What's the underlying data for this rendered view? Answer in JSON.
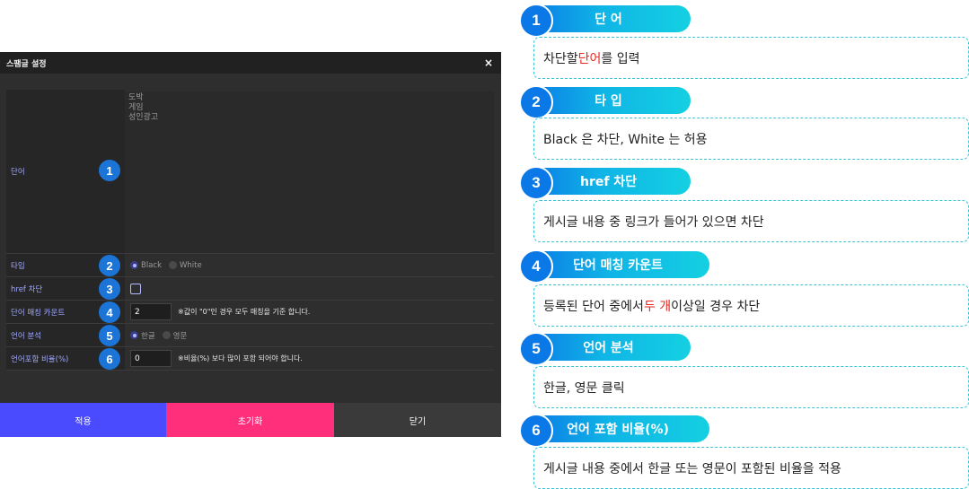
{
  "dialog": {
    "title": "스팸글 설정",
    "close_glyph": "×",
    "rows": {
      "word": {
        "label": "단어",
        "value": "도박\n게임\n성인광고",
        "badge": "1"
      },
      "type": {
        "label": "타입",
        "badge": "2",
        "options": [
          "Black",
          "White"
        ],
        "selected": "Black"
      },
      "href": {
        "label": "href 차단",
        "badge": "3",
        "checked": false
      },
      "count": {
        "label": "단어 매칭 카운트",
        "badge": "4",
        "value": "2",
        "hint": "※값이 \"0\"인 경우 모두 매칭을 기준 합니다."
      },
      "lang": {
        "label": "언어 분석",
        "badge": "5",
        "options": [
          "한글",
          "영문"
        ],
        "selected": "한글"
      },
      "ratio": {
        "label": "언어포함 비율(%)",
        "badge": "6",
        "value": "0",
        "hint": "※비율(%) 보다 많이 포함 되어야 합니다."
      }
    },
    "buttons": {
      "apply": "적용",
      "reset": "초기화",
      "close": "닫기"
    },
    "colors": {
      "apply": "#4a4bff",
      "reset": "#ff2f7c",
      "close": "#3a3a3a",
      "badge": "#1b74d6"
    }
  },
  "guide": {
    "items": [
      {
        "num": "1",
        "title": "단 어",
        "desc_pre": "차단할 ",
        "desc_red": "단어",
        "desc_post": "를 입력"
      },
      {
        "num": "2",
        "title": "타 입",
        "desc_pre": "Black 은 차단, White 는 허용",
        "desc_red": "",
        "desc_post": ""
      },
      {
        "num": "3",
        "title": "href 차단",
        "desc_pre": "게시글 내용 중 링크가 들어가 있으면 차단",
        "desc_red": "",
        "desc_post": ""
      },
      {
        "num": "4",
        "title": "단어 매칭 카운트",
        "desc_pre": "등록된 단어 중에서 ",
        "desc_red": "두 개",
        "desc_post": " 이상일 경우 차단"
      },
      {
        "num": "5",
        "title": "언어 분석",
        "desc_pre": "한글, 영문 클릭",
        "desc_red": "",
        "desc_post": ""
      },
      {
        "num": "6",
        "title": "언어 포함 비율(%)",
        "desc_pre": "게시글 내용 중에서 한글 또는 영문이 포함된 비율을 적용",
        "desc_red": "",
        "desc_post": ""
      }
    ],
    "colors": {
      "accent": "#0a78e6",
      "accent_end": "#14d0e2",
      "border": "#37c4d6",
      "highlight": "#e8261f"
    }
  }
}
